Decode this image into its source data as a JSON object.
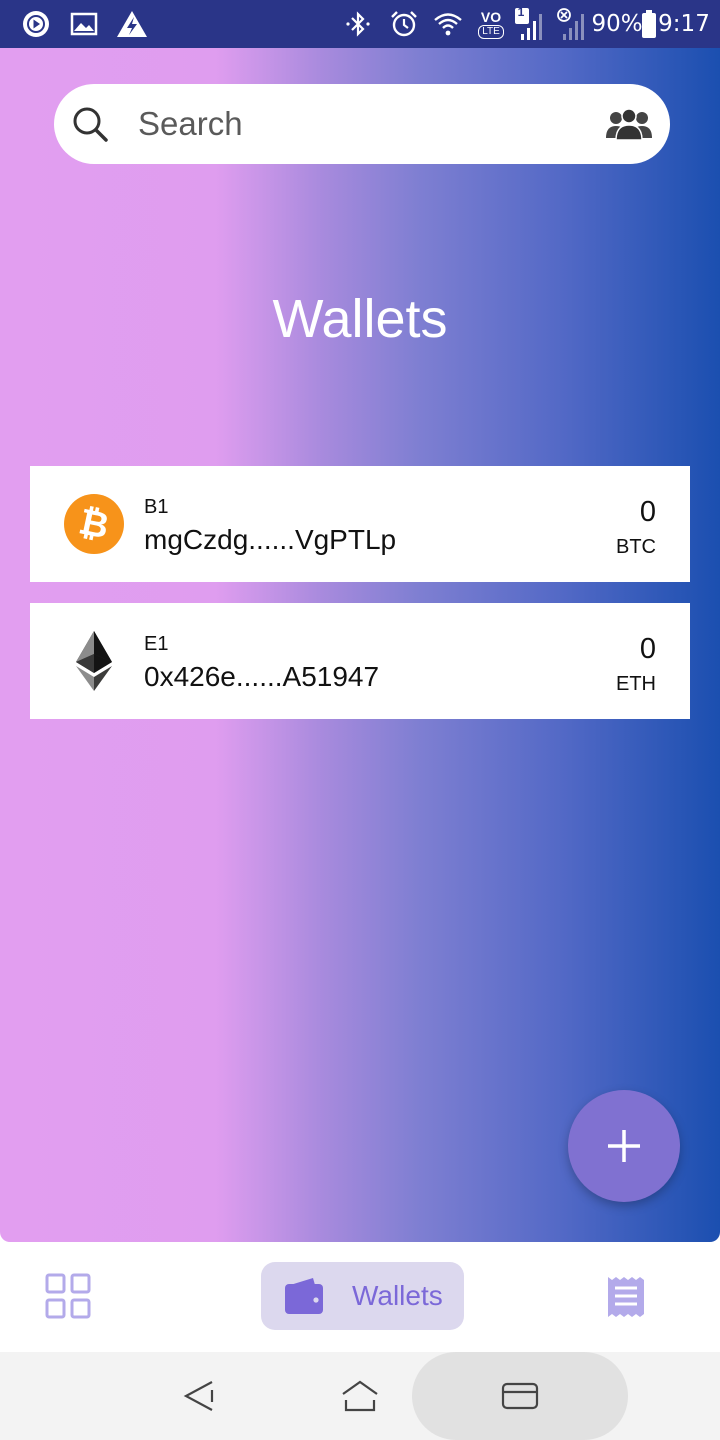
{
  "status_bar": {
    "battery": "90%",
    "time": "9:17",
    "sim_badge": "1",
    "volte_top": "VO",
    "volte_bottom": "LTE",
    "icons": [
      "media-play-icon",
      "gallery-icon",
      "power-saver-icon",
      "bluetooth-icon",
      "alarm-icon",
      "wifi-icon",
      "volte-icon",
      "signal-sim1-icon",
      "signal-sim2-icon",
      "battery-icon"
    ]
  },
  "search": {
    "placeholder": "Search",
    "icon": "search-icon",
    "action_icon": "contacts-icon"
  },
  "page_title": "Wallets",
  "wallets": [
    {
      "name": "B1",
      "address": "mgCzdg......VgPTLp",
      "balance": "0",
      "symbol": "BTC",
      "icon": "bitcoin-icon",
      "color": "#f7931a"
    },
    {
      "name": "E1",
      "address": "0x426e......A51947",
      "balance": "0",
      "symbol": "ETH",
      "icon": "ethereum-icon",
      "color": "#343434"
    }
  ],
  "fab": {
    "icon": "plus-icon",
    "color": "#8071d1"
  },
  "bottom_nav": {
    "items": [
      {
        "id": "dashboard",
        "icon": "grid-icon",
        "label": ""
      },
      {
        "id": "wallets",
        "icon": "wallet-icon",
        "label": "Wallets",
        "active": true
      },
      {
        "id": "transactions",
        "icon": "receipt-icon",
        "label": ""
      }
    ],
    "active_color": "#7b68d8",
    "active_bg": "#dcd8ee"
  },
  "system_nav": {
    "icons": [
      "back-icon",
      "home-icon",
      "recents-icon"
    ]
  },
  "colors": {
    "status_bar": "#2a3588",
    "gradient_left": "#e29ef0",
    "gradient_right": "#1b4fb0"
  }
}
